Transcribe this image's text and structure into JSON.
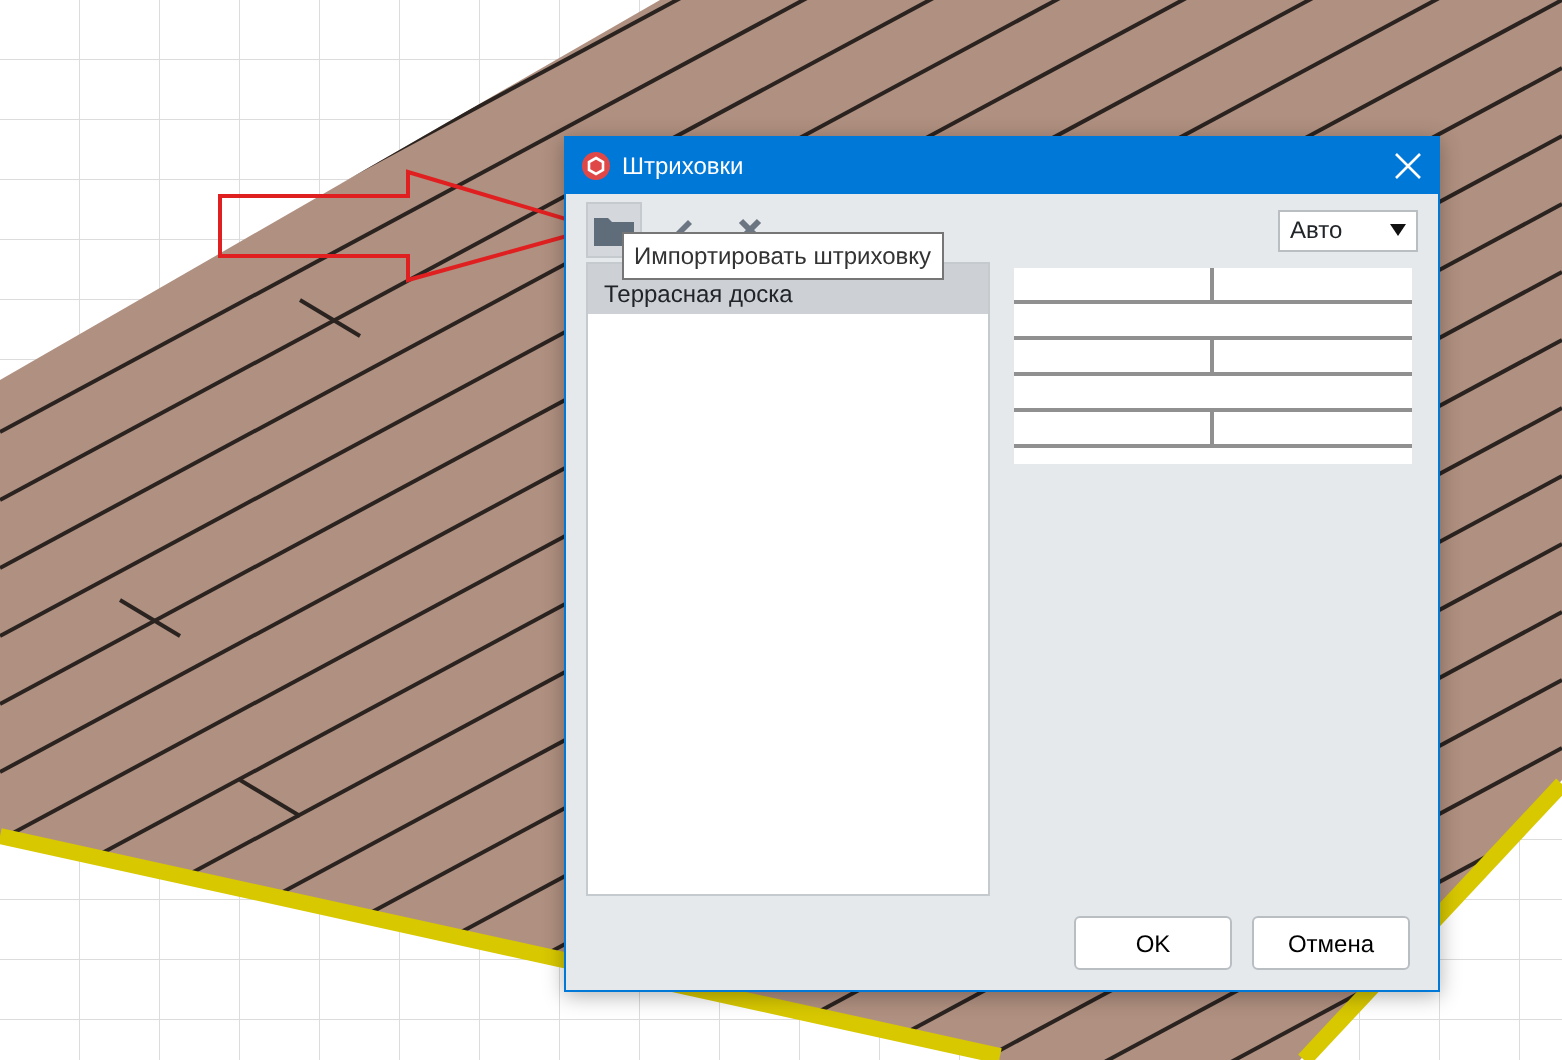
{
  "window": {
    "title": "Штриховки"
  },
  "toolbar": {
    "tooltip": "Импортировать штриховку",
    "dropdown": {
      "value": "Авто"
    }
  },
  "list": {
    "items": [
      {
        "label": "Террасная доска",
        "selected": true
      }
    ]
  },
  "buttons": [
    "OK",
    "Отмена"
  ]
}
